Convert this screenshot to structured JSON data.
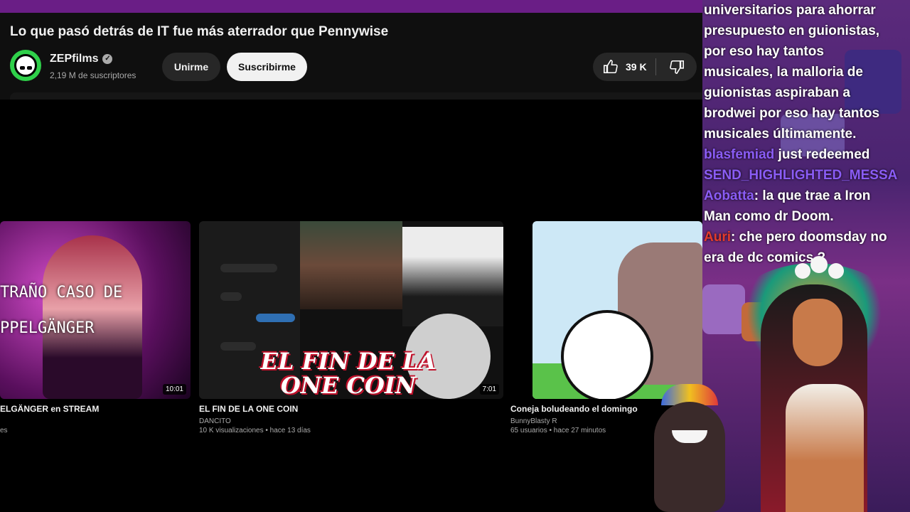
{
  "video": {
    "title": "Lo que pasó detrás de IT fue más aterrador que Pennywise",
    "channel": "ZEPfilms",
    "subscribers": "2,19 M de suscriptores",
    "join_label": "Unirme",
    "subscribe_label": "Suscribirme",
    "likes": "39 K"
  },
  "related": [
    {
      "title": "ELGÄNGER en STREAM",
      "meta": "es",
      "duration": "10:01",
      "overlay1": "TRAÑO CASO DE",
      "overlay2": "PPELGÄNGER"
    },
    {
      "title": "EL FIN DE LA ONE COIN",
      "channel": "DANCITO",
      "meta": "10 K visualizaciones • hace 13 días",
      "duration": "7:01",
      "overlay": "EL FIN DE LA ONE COIN"
    },
    {
      "title": "Coneja boludeando el domingo",
      "channel": "BunnyBlasty R",
      "meta": "65 usuarios • hace 27 minutos"
    }
  ],
  "chat": {
    "lines": [
      {
        "text": "universitarios para ahorrar"
      },
      {
        "text": "presupuesto en guionistas,"
      },
      {
        "text": "por eso hay tantos"
      },
      {
        "text": "musicales, la malloria de"
      },
      {
        "text": "guionistas aspiraban a"
      },
      {
        "text": "brodwei por eso hay tantos"
      },
      {
        "text": "musicales últimamente."
      }
    ],
    "redeem_user": "blasfemiad",
    "redeem_text": " just redeemed",
    "redeem_item": "SEND_HIGHLIGHTED_MESSA",
    "msg1_user": "Aobatta",
    "msg1_text": ": la que trae a Iron",
    "msg1_text2": "Man como dr Doom.",
    "msg2_user": "Auri",
    "msg2_text": ": che pero doomsday no",
    "msg2_text2": "era de dc comics ?"
  },
  "colors": {
    "accent": "#6a1e86",
    "subscribe_bg": "#f1f1f1",
    "chat_user": "#8a5cf5"
  }
}
